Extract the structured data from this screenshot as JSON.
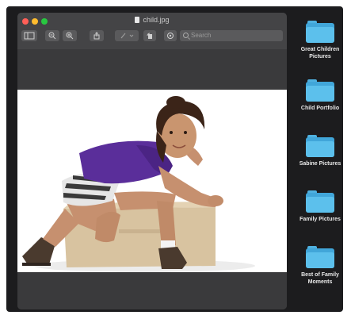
{
  "window": {
    "title": "child.jpg",
    "search_placeholder": "Search"
  },
  "colors": {
    "close": "#ff5f57",
    "minimize": "#febc2e",
    "zoom": "#28c840",
    "folder": "#5cc0ec"
  },
  "toolbar": {
    "icons": [
      "sidebar-icon",
      "zoom-out-icon",
      "zoom-in-icon",
      "share-icon",
      "markup-icon",
      "rotate-icon",
      "annotate-icon"
    ]
  },
  "folders": [
    {
      "label": "Great Children Pictures"
    },
    {
      "label": "Child Portfolio"
    },
    {
      "label": "Sabine Pictures"
    },
    {
      "label": "Family Pictures"
    },
    {
      "label": "Best of Family Moments"
    }
  ]
}
